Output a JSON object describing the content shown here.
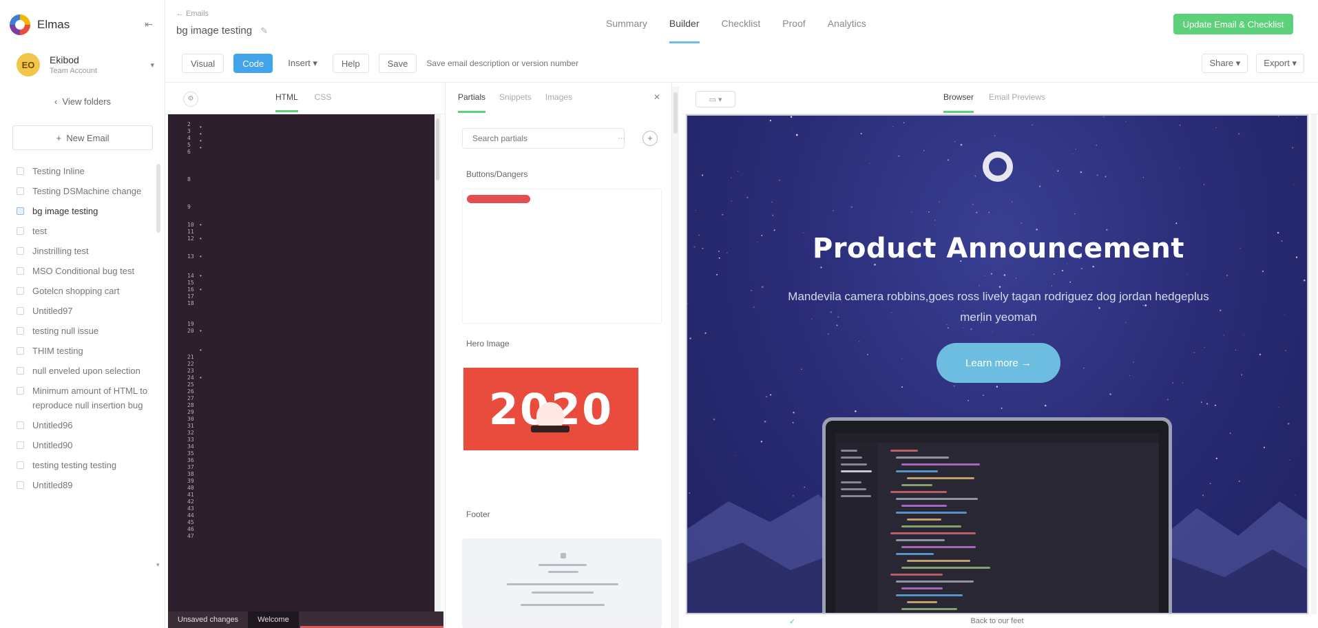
{
  "app": {
    "name": "Elmas",
    "logo_icon": "multicolor-ring-logo",
    "collapse_icon": "collapse-sidebar-icon"
  },
  "team": {
    "avatar_initials": "EO",
    "name": "Ekibod",
    "subtitle": "Team Account"
  },
  "sidebar": {
    "show_folders": "View folders",
    "new_email": "New Email",
    "emails": [
      {
        "label": "Testing Inline",
        "active": false
      },
      {
        "label": "Testing DSMachine change",
        "active": false
      },
      {
        "label": "bg image testing",
        "active": true
      },
      {
        "label": "test",
        "active": false
      },
      {
        "label": "Jinstrilling test",
        "active": false
      },
      {
        "label": "MSO Conditional bug test",
        "active": false
      },
      {
        "label": "Gotelcn shopping cart",
        "active": false
      },
      {
        "label": "Untitled97",
        "active": false
      },
      {
        "label": "testing null issue",
        "active": false
      },
      {
        "label": "THIM testing",
        "active": false
      },
      {
        "label": "null enveled upon selection",
        "active": false
      },
      {
        "label": "Minimum amount of HTML to reproduce null insertion bug",
        "active": false
      },
      {
        "label": "Untitled96",
        "active": false
      },
      {
        "label": "Untitled90",
        "active": false
      },
      {
        "label": "testing testing testing",
        "active": false
      },
      {
        "label": "Untitled89",
        "active": false
      }
    ]
  },
  "header": {
    "breadcrumb": "← Emails",
    "title": "bg image testing",
    "edit_icon": "pencil-icon",
    "nav_tabs": [
      {
        "label": "Summary",
        "active": false
      },
      {
        "label": "Builder",
        "active": true
      },
      {
        "label": "Checklist",
        "active": false
      },
      {
        "label": "Proof",
        "active": false
      },
      {
        "label": "Analytics",
        "active": false
      }
    ],
    "update_button": "Update Email & Checklist"
  },
  "toolbar": {
    "visual": "Visual",
    "code": "Code",
    "insert": "Insert ▾",
    "help": "Help",
    "save": "Save",
    "description_placeholder": "Save email description or version number",
    "share": "Share ▾",
    "export": "Export ▾"
  },
  "code_pane": {
    "tabs": [
      {
        "label": "HTML",
        "active": true
      },
      {
        "label": "CSS",
        "active": false
      }
    ],
    "line_numbers": [
      "2",
      "3",
      "4",
      "5",
      "6",
      "8",
      "9",
      "10",
      "11",
      "12",
      "13",
      "14",
      "15",
      "16",
      "17",
      "18",
      "19",
      "20",
      "21",
      "22",
      "23",
      "24",
      "25",
      "26",
      "27",
      "28",
      "29",
      "30",
      "31",
      "32",
      "33",
      "34",
      "35",
      "36",
      "37",
      "38",
      "39",
      "40",
      "41",
      "42",
      "43",
      "44",
      "45",
      "46",
      "47"
    ],
    "footer_tabs": [
      "Unsaved changes",
      "Welcome"
    ]
  },
  "partials": {
    "tabs": [
      {
        "label": "Partials",
        "active": true
      },
      {
        "label": "Snippets",
        "active": false
      },
      {
        "label": "Images",
        "active": false
      }
    ],
    "search_placeholder": "Search partials",
    "add_icon": "plus-icon",
    "sections": [
      "Buttons/Dangers",
      "Hero Image",
      "Footer"
    ],
    "hero_image_text": "2020"
  },
  "preview": {
    "tabs": [
      {
        "label": "Browser",
        "active": true
      },
      {
        "label": "Email Previews",
        "active": false
      }
    ],
    "device_icon": "monitor-icon",
    "hero_title": "Product Announcement",
    "hero_subtitle": "Mandevila camera robbins,goes ross lively tagan rodriguez dog jordan hedgeplus merlin yeoman",
    "hero_button": "Learn more →",
    "footer_text": "Back to our feet",
    "colors": {
      "bg_top": "#3a3f93",
      "bg_bottom": "#1f2160",
      "button": "#6cbddf"
    }
  }
}
